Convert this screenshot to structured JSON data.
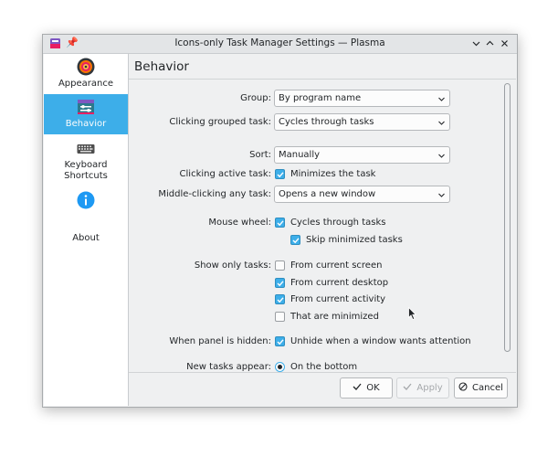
{
  "window": {
    "title": "Icons-only Task Manager Settings — Plasma",
    "buttons": [
      "chevron-down-icon",
      "chevron-up-icon",
      "close-icon"
    ]
  },
  "sidebar": {
    "items": [
      {
        "label": "Appearance",
        "icon": "appearance-icon",
        "active": false
      },
      {
        "label": "Behavior",
        "icon": "behavior-icon",
        "active": true
      },
      {
        "label": "Keyboard Shortcuts",
        "icon": "keyboard-icon",
        "active": false
      },
      {
        "label": "About",
        "icon": "info-icon",
        "active": false
      }
    ]
  },
  "page": {
    "title": "Behavior",
    "group": {
      "label": "Group:",
      "value": "By program name"
    },
    "clicking_grouped": {
      "label": "Clicking grouped task:",
      "value": "Cycles through tasks"
    },
    "sort": {
      "label": "Sort:",
      "value": "Manually"
    },
    "clicking_active": {
      "label": "Clicking active task:",
      "option": "Minimizes the task",
      "checked": true
    },
    "middle_click": {
      "label": "Middle-clicking any task:",
      "value": "Opens a new window"
    },
    "mouse_wheel": {
      "label": "Mouse wheel:",
      "cycles": {
        "option": "Cycles through tasks",
        "checked": true
      },
      "skip_minimized": {
        "option": "Skip minimized tasks",
        "checked": true
      }
    },
    "show_only": {
      "label": "Show only tasks:",
      "options": [
        {
          "option": "From current screen",
          "checked": false
        },
        {
          "option": "From current desktop",
          "checked": true
        },
        {
          "option": "From current activity",
          "checked": true
        },
        {
          "option": "That are minimized",
          "checked": false
        }
      ]
    },
    "panel_hidden": {
      "label": "When panel is hidden:",
      "option": "Unhide when a window wants attention",
      "checked": true
    },
    "new_tasks": {
      "label": "New tasks appear:",
      "option": "On the bottom",
      "selected": true
    }
  },
  "buttons": {
    "ok": "OK",
    "apply": "Apply",
    "cancel": "Cancel"
  },
  "colors": {
    "accent": "#3daee9",
    "window_bg": "#eff0f1",
    "text": "#232629"
  }
}
